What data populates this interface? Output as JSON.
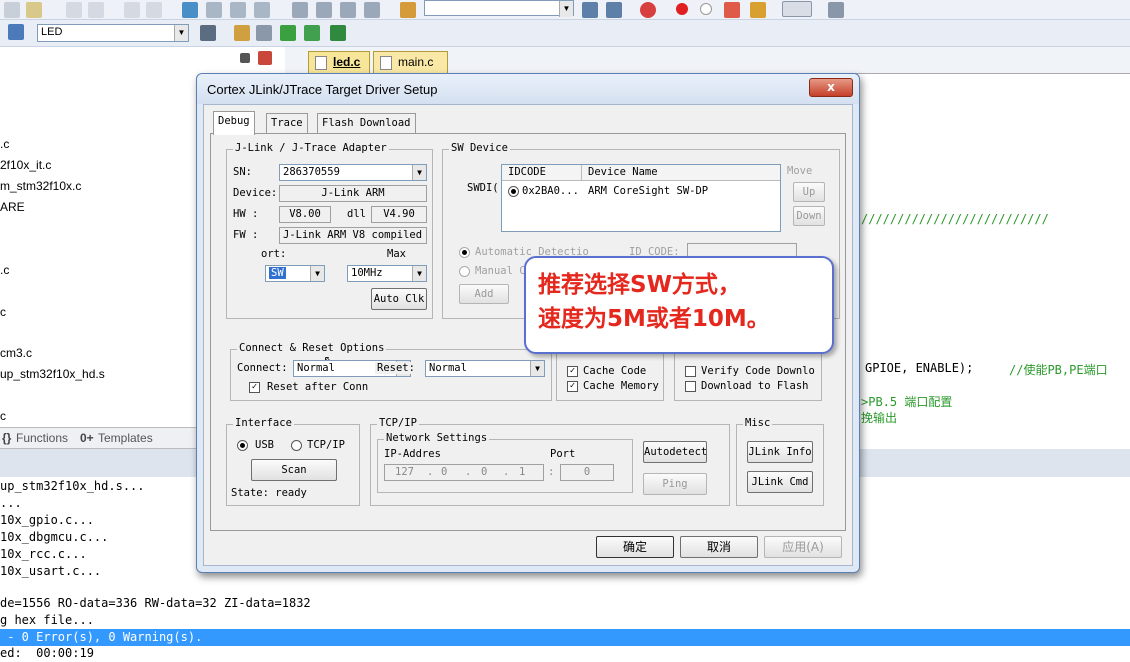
{
  "toolbar": {
    "target_value": "LED"
  },
  "editor_tabs": [
    {
      "label": "led.c"
    },
    {
      "label": "main.c"
    }
  ],
  "file_tree": [
    ".c",
    "2f10x_it.c",
    "m_stm32f10x.c",
    "ARE",
    ".c",
    "c",
    "cm3.c",
    "up_stm32f10x_hd.s",
    "c"
  ],
  "left_tabs": {
    "functions": "Functions",
    "templates": "Templates"
  },
  "editor": {
    "comment_slashes": "//////////////////////////",
    "code_line": "GPIOE, ENABLE);",
    "code_comment": "//使能PB,PE端口",
    "comment2": ">PB.5 端口配置",
    "comment3": "挽输出"
  },
  "output_lines": [
    "up_stm32f10x_hd.s...",
    "...",
    "10x_gpio.c...",
    "10x_dbgmcu.c...",
    "10x_rcc.c...",
    "10x_usart.c...",
    "",
    "de=1556 RO-data=336 RW-data=32 ZI-data=1832",
    "g hex file...",
    " - 0 Error(s), 0 Warning(s).",
    "ed:  00:00:19"
  ],
  "dialog": {
    "title": "Cortex JLink/JTrace Target Driver Setup",
    "close_label": "x",
    "tabs": [
      "Debug",
      "Trace",
      "Flash Download"
    ],
    "adapter": {
      "group_label": "J-Link / J-Trace Adapter",
      "sn_label": "SN:",
      "sn_value": "286370559",
      "device_label": "Device:",
      "device_value": "J-Link ARM",
      "hw_label": "HW :",
      "hw_value": "V8.00",
      "dll_label": "dll",
      "dll_value": "V4.90",
      "fw_label": "FW :",
      "fw_value": "J-Link ARM V8 compiled",
      "port_label": "ort:",
      "port_value": "SW",
      "max_label": "Max",
      "max_value": "10MHz",
      "autoclk_label": "Auto Clk"
    },
    "sw_device": {
      "group_label": "SW Device",
      "swdi_label": "SWDI(",
      "col_idcode": "IDCODE",
      "col_device": "Device Name",
      "row_idcode": "0x2BA0...",
      "row_device": "ARM CoreSight SW-DP",
      "move_label": "Move",
      "up_label": "Up",
      "down_label": "Down",
      "auto_detect_label": "Automatic Detectio",
      "idcode_label": "ID CODE:",
      "manual_label": "Manual C",
      "add_label": "Add"
    },
    "connect_reset": {
      "group_label": "Connect & Reset Options",
      "connect_label": "Connect:",
      "connect_value": "Normal",
      "reset_label": "Reset:",
      "reset_value": "Normal",
      "reset_after_conn": "Reset after Conn"
    },
    "cache": {
      "cache_code": "Cache Code",
      "cache_memory": "Cache Memory"
    },
    "download": {
      "verify": "Verify Code Downlo",
      "download_flash": "Download to Flash"
    },
    "interface": {
      "group_label": "Interface",
      "usb_label": "USB",
      "tcpip_label": "TCP/IP",
      "scan_label": "Scan",
      "state_label": "State: ready"
    },
    "tcpip": {
      "group_label": "TCP/IP",
      "network_label": "Network Settings",
      "ip_label": "IP-Addres",
      "port_label": "Port",
      "ip_values": [
        "127",
        "0",
        "0",
        "1"
      ],
      "port_value": "0",
      "autodetect_label": "Autodetect",
      "ping_label": "Ping"
    },
    "misc": {
      "group_label": "Misc",
      "jlink_info": "JLink Info",
      "jlink_cmd": "JLink Cmd"
    },
    "buttons": {
      "ok": "确定",
      "cancel": "取消",
      "apply": "应用(A)"
    }
  },
  "callout": {
    "line1": "推荐选择SW方式，",
    "line2": "速度为5M或者10M。"
  }
}
